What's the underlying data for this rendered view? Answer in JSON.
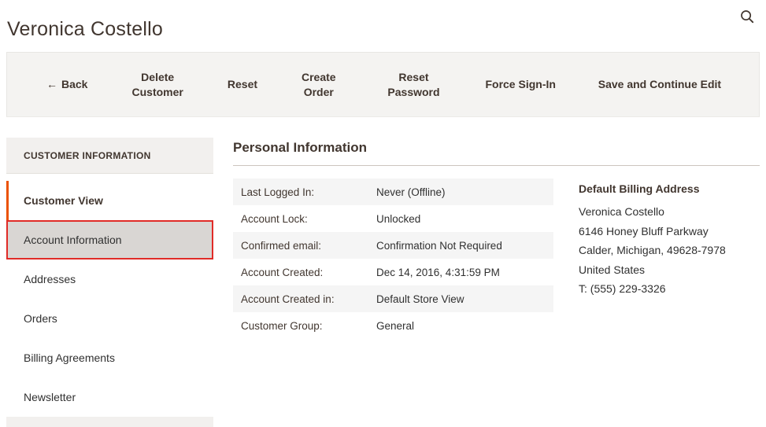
{
  "page": {
    "title": "Veronica Costello"
  },
  "icons": {
    "back_arrow": "←",
    "search": "magnifier"
  },
  "toolbar": {
    "buttons": [
      {
        "label": "Back"
      },
      {
        "label": "Delete Customer"
      },
      {
        "label": "Reset"
      },
      {
        "label": "Create Order"
      },
      {
        "label": "Reset Password"
      },
      {
        "label": "Force Sign-In"
      },
      {
        "label": "Save and Continue Edit"
      }
    ]
  },
  "sidebar": {
    "header": "CUSTOMER INFORMATION",
    "items": [
      {
        "label": "Customer View",
        "state": "active"
      },
      {
        "label": "Account Information",
        "state": "selected-highlighted-red"
      },
      {
        "label": "Addresses",
        "state": "normal"
      },
      {
        "label": "Orders",
        "state": "normal"
      },
      {
        "label": "Billing Agreements",
        "state": "normal"
      },
      {
        "label": "Newsletter",
        "state": "normal"
      }
    ]
  },
  "main": {
    "section_title": "Personal Information",
    "info_rows": [
      {
        "label": "Last Logged In:",
        "value": "Never (Offline)"
      },
      {
        "label": "Account Lock:",
        "value": "Unlocked"
      },
      {
        "label": "Confirmed email:",
        "value": "Confirmation Not Required"
      },
      {
        "label": "Account Created:",
        "value": "Dec 14, 2016, 4:31:59 PM"
      },
      {
        "label": "Account Created in:",
        "value": "Default Store View"
      },
      {
        "label": "Customer Group:",
        "value": "General"
      }
    ],
    "billing_address": {
      "title": "Default Billing Address",
      "lines": [
        "Veronica Costello",
        "6146 Honey Bluff Parkway",
        "Calder, Michigan, 49628-7978",
        "United States",
        "T: (555) 229-3326"
      ]
    }
  },
  "colors": {
    "accent_orange": "#eb5202",
    "highlight_red": "#e02b27",
    "toolbar_bg": "#f4f3f1",
    "sidebar_header_bg": "#f2f0ee",
    "selected_item_bg": "#d9d6d3",
    "row_shade": "#f5f5f5",
    "heading_text": "#41362f"
  }
}
